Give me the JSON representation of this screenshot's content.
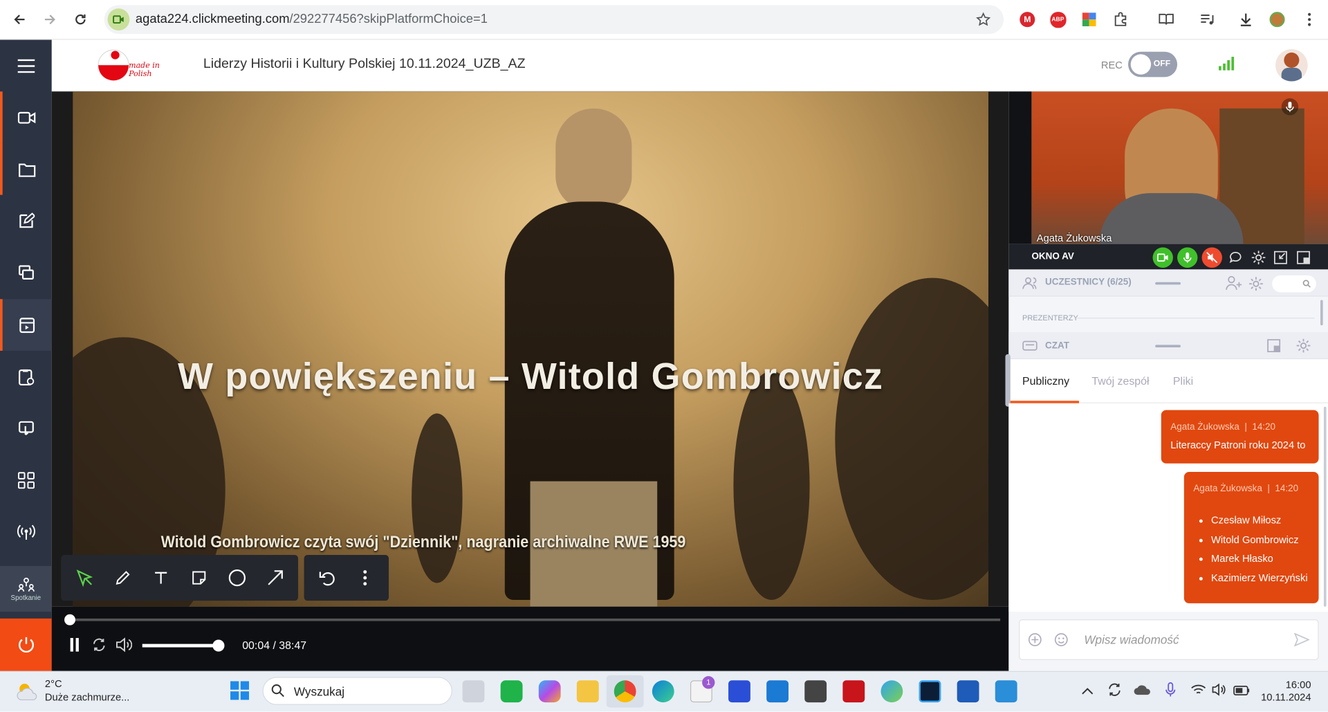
{
  "browser": {
    "url_domain": "agata224.clickmeeting.com",
    "url_path": "/292277456?skipPlatformChoice=1"
  },
  "header": {
    "logo_text": "made in Polish",
    "meeting_title": "Liderzy Historii i Kultury Polskiej 10.11.2024_UZB_AZ",
    "rec_label": "REC",
    "rec_toggle": "OFF"
  },
  "sidebar": {
    "spotkanie_label": "Spotkanie"
  },
  "video": {
    "title_overlay": "W powiększeniu – Witold Gombrowicz",
    "caption": "Witold Gombrowicz czyta swój \"Dziennik\", nagranie archiwalne RWE 1959",
    "time": "00:04 / 38:47",
    "volume_fraction": 0.95,
    "progress_fraction": 0.002
  },
  "av": {
    "person_name": "Agata Żukowska",
    "label": "OKNO AV"
  },
  "participants": {
    "label": "UCZESTNICY (6/25)",
    "presenters_label": "PREZENTERZY"
  },
  "chat": {
    "section_label": "CZAT",
    "tabs": [
      "Publiczny",
      "Twój zespół",
      "Pliki"
    ],
    "messages": [
      {
        "author": "Agata Żukowska",
        "time": "14:20",
        "text": "Literaccy Patroni roku 2024 to"
      },
      {
        "author": "Agata Żukowska",
        "time": "14:20",
        "items": [
          "Czesław Miłosz",
          "Witold Gombrowicz",
          "Marek Hłasko",
          "Kazimierz Wierzyński"
        ]
      }
    ],
    "input_placeholder": "Wpisz wiadomość"
  },
  "taskbar": {
    "weather_temp": "2°C",
    "weather_desc": "Duże zachmurze...",
    "search_text": "Wyszukaj",
    "store_badge": "1",
    "time": "16:00",
    "date": "10.11.2024"
  },
  "colors": {
    "accent": "#f25a1e",
    "sidebar": "#2c3342",
    "bubble": "#e0480f"
  }
}
